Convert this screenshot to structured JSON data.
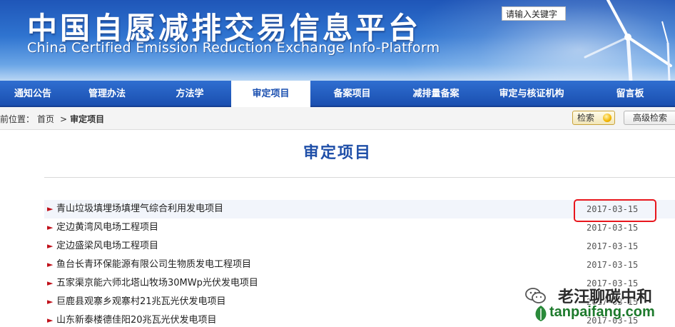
{
  "banner": {
    "title_cn": "中国自愿减排交易信息平台",
    "title_en": "China Certified Emission Reduction Exchange Info-Platform"
  },
  "nav": {
    "items": [
      {
        "label": "通知公告",
        "active": false
      },
      {
        "label": "管理办法",
        "active": false
      },
      {
        "label": "方法学",
        "active": false
      },
      {
        "label": "审定项目",
        "active": true
      },
      {
        "label": "备案项目",
        "active": false
      },
      {
        "label": "减排量备案",
        "active": false
      },
      {
        "label": "审定与核证机构",
        "active": false
      },
      {
        "label": "留言板",
        "active": false
      }
    ]
  },
  "breadcrumb": {
    "prefix": "当前位置：",
    "home": "首页",
    "separator": ">",
    "current": "审定项目"
  },
  "search": {
    "value": "请输入关键字",
    "search_label": "检索",
    "advanced_label": "高级检索"
  },
  "page": {
    "title": "审定项目"
  },
  "projects": [
    {
      "title": "青山垃圾填埋场填埋气综合利用发电项目",
      "date": "2017-03-15"
    },
    {
      "title": "定边黄湾风电场工程项目",
      "date": "2017-03-15"
    },
    {
      "title": "定边盛梁风电场工程项目",
      "date": "2017-03-15"
    },
    {
      "title": "鱼台长青环保能源有限公司生物质发电工程项目",
      "date": "2017-03-15"
    },
    {
      "title": "五家渠京能六师北塔山牧场30MWp光伏发电项目",
      "date": "2017-03-15"
    },
    {
      "title": "巨鹿县观寨乡观寨村21兆瓦光伏发电项目",
      "date": "2017-03-15"
    },
    {
      "title": "山东新泰楼德佳阳20兆瓦光伏发电项目",
      "date": "2017-03-15"
    }
  ],
  "watermark": {
    "brand": "老汪聊碳中和",
    "site": "tanpaifang.com"
  },
  "colors": {
    "nav_blue": "#1a4fb0",
    "title_blue": "#1f4fa8",
    "arrow_red": "#c0101a",
    "annotation_red": "#e8161d",
    "watermark_green": "#1d7a2c"
  }
}
